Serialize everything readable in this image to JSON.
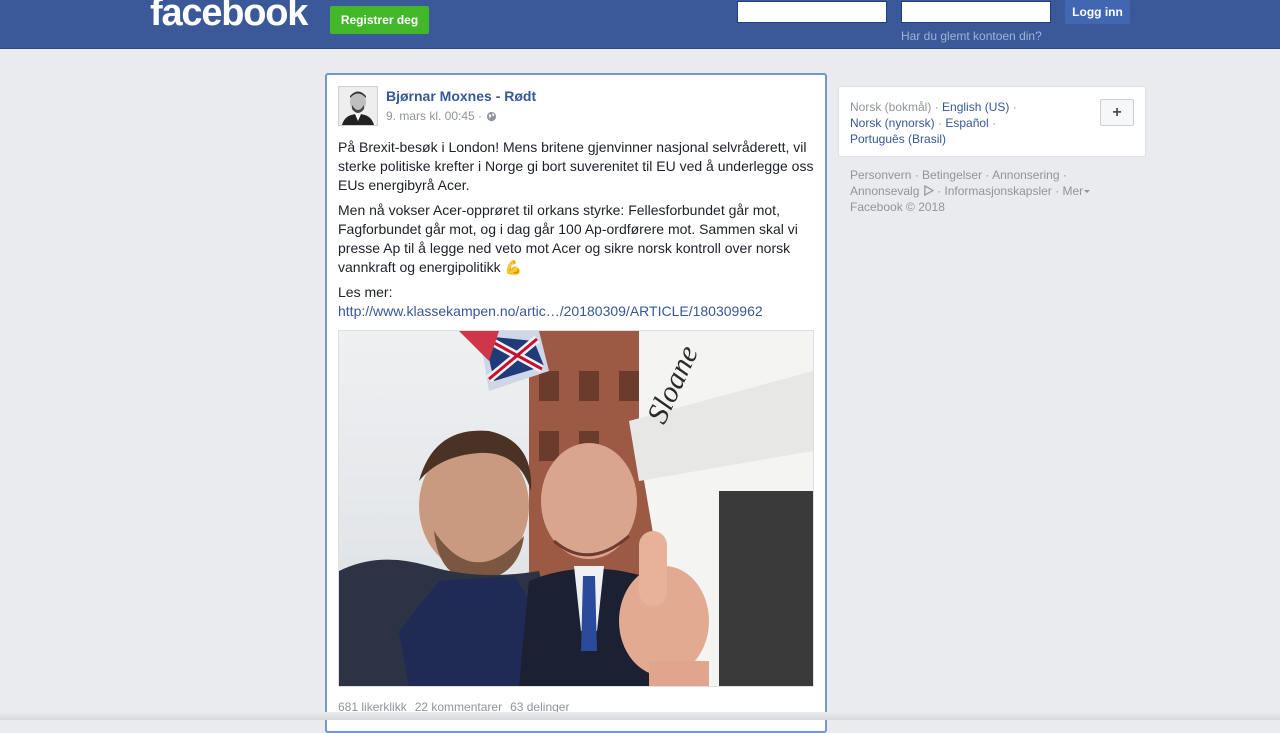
{
  "header": {
    "logo": "facebook",
    "signup_label": "Registrer deg",
    "login_label": "Logg inn",
    "forgot_label": "Har du glemt kontoen din?"
  },
  "post": {
    "author": "Bjørnar Moxnes - Rødt",
    "timestamp": "9. mars kl. 00:45 ·",
    "paragraph1": "På Brexit-besøk i London! Mens britene gjenvinner nasjonal selvråderett, vil sterke politiske krefter i Norge gi bort suverenitet til EU ved å underlegge oss EUs energibyrå Acer.",
    "paragraph2": "Men nå vokser Acer-opprøret til orkans styrke: Fellesforbundet går mot, Fagforbundet går mot, og i dag går 100 Ap-ordførere mot. Sammen skal vi presse Ap til å legge ned veto mot Acer og sikre norsk kontroll over norsk vannkraft og energipolitikk 💪",
    "read_more": "Les mer:",
    "link": "http://www.klassekampen.no/artic…/20180309/ARTICLE/180309962",
    "photo_sign": "Sloane",
    "likes": "681 likerklikk",
    "comments": "22 kommentarer",
    "shares": "63 delinger"
  },
  "languages": {
    "current": "Norsk (bokmål)",
    "english": "English (US)",
    "nynorsk": "Norsk (nynorsk)",
    "espanol": "Español",
    "portugues": "Português (Brasil)",
    "add_label": "+"
  },
  "footer": {
    "personvern": "Personvern",
    "betingelser": "Betingelser",
    "annonsering": "Annonsering",
    "annonsevalg": "Annonsevalg",
    "informasjonskapsler": "Informasjonskapsler",
    "mer": "Mer",
    "copyright": "Facebook © 2018"
  }
}
